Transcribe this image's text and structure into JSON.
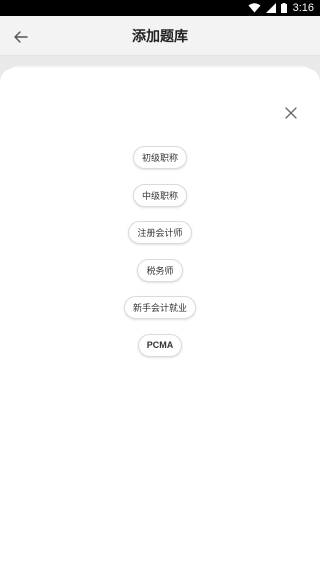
{
  "status_bar": {
    "time": "3:16",
    "icons": [
      "wifi-icon",
      "signal-icon",
      "battery-icon"
    ]
  },
  "header": {
    "title": "添加题库",
    "back_icon": "arrow-left-icon"
  },
  "modal": {
    "close_icon": "close-icon",
    "options": [
      {
        "label": "初级职称"
      },
      {
        "label": "中级职称"
      },
      {
        "label": "注册会计师"
      },
      {
        "label": "税务师"
      },
      {
        "label": "新手会计就业"
      },
      {
        "label": "PCMA"
      }
    ]
  },
  "colors": {
    "status_bar_bg": "#000000",
    "app_bar_bg": "#f3f3f3",
    "sheet_bg": "#ffffff",
    "pill_border": "#dadada",
    "text": "#333333"
  }
}
